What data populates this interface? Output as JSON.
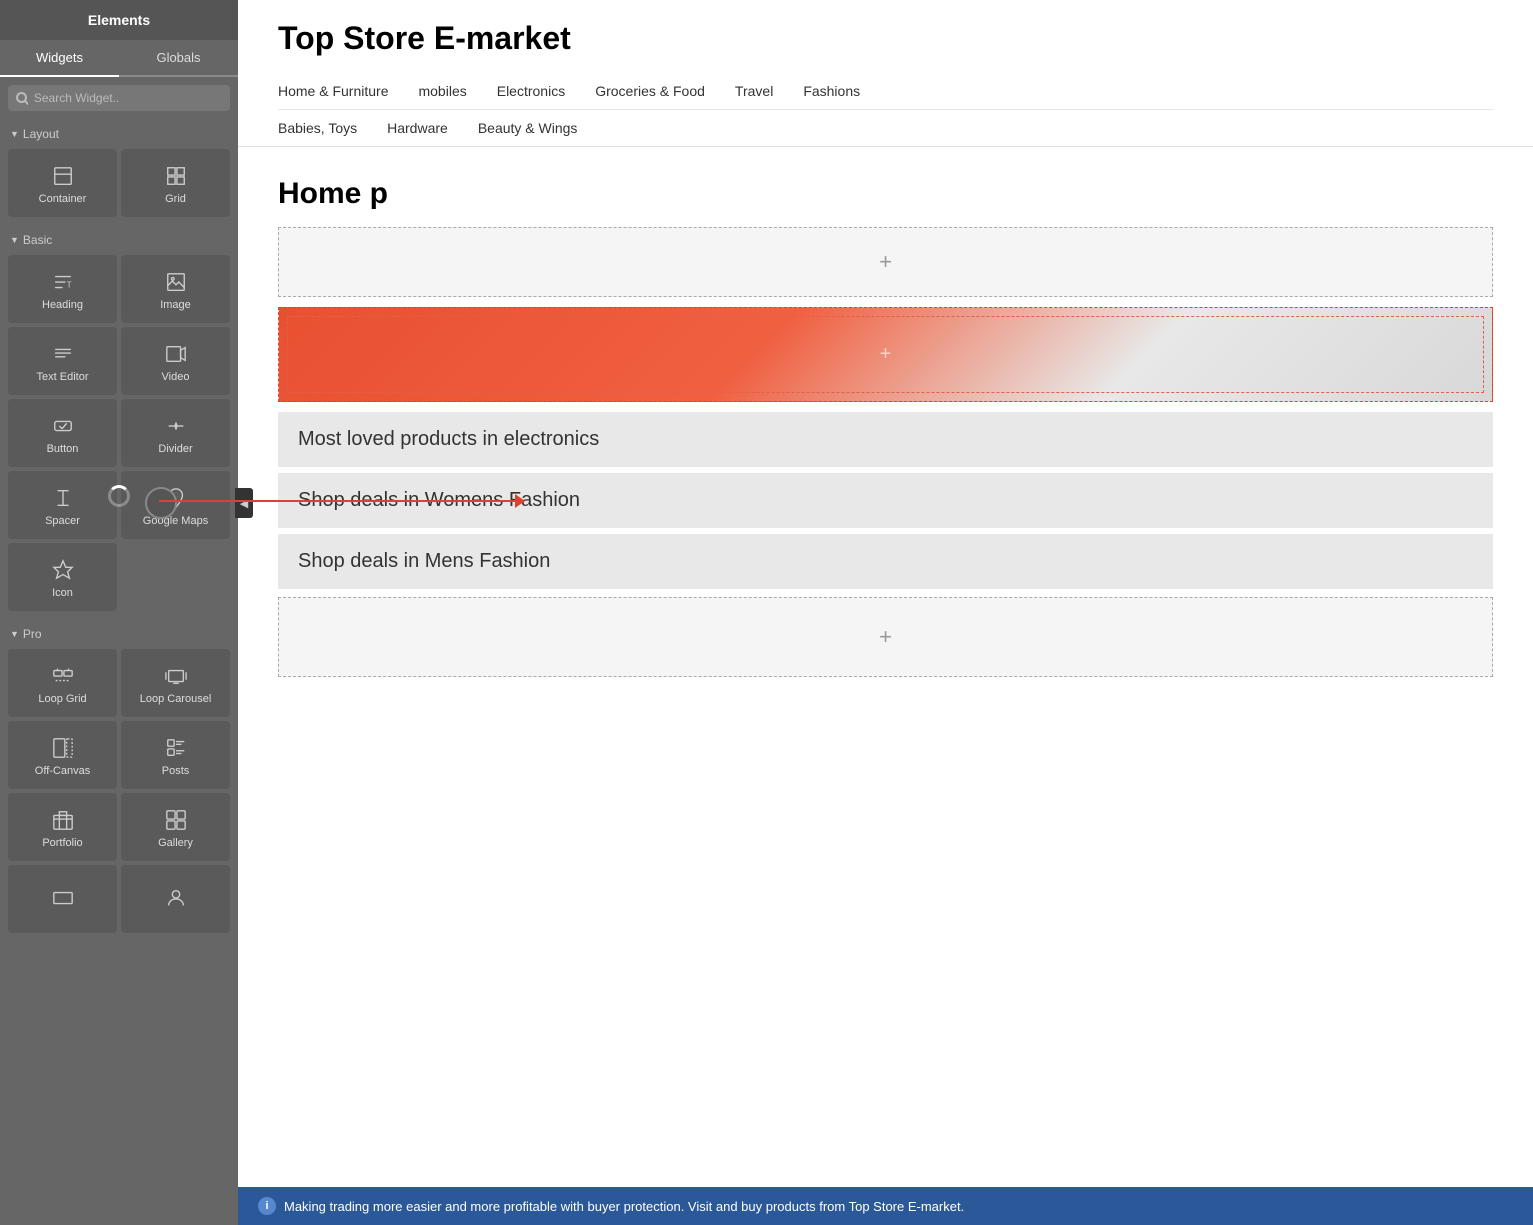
{
  "sidebar": {
    "title": "Elements",
    "tabs": [
      {
        "label": "Widgets",
        "active": true
      },
      {
        "label": "Globals",
        "active": false
      }
    ],
    "search": {
      "placeholder": "Search Widget.."
    },
    "sections": {
      "layout": {
        "label": "Layout",
        "widgets": [
          {
            "name": "container",
            "label": "Container"
          },
          {
            "name": "grid",
            "label": "Grid"
          }
        ]
      },
      "basic": {
        "label": "Basic",
        "widgets": [
          {
            "name": "heading",
            "label": "Heading"
          },
          {
            "name": "image",
            "label": "Image"
          },
          {
            "name": "text-editor",
            "label": "Text Editor"
          },
          {
            "name": "video",
            "label": "Video"
          },
          {
            "name": "button",
            "label": "Button"
          },
          {
            "name": "divider",
            "label": "Divider"
          },
          {
            "name": "spacer",
            "label": "Spacer"
          },
          {
            "name": "google-maps",
            "label": "Google Maps"
          },
          {
            "name": "icon",
            "label": "Icon"
          }
        ]
      },
      "pro": {
        "label": "Pro",
        "widgets": [
          {
            "name": "loop-grid",
            "label": "Loop Grid"
          },
          {
            "name": "loop-carousel",
            "label": "Loop Carousel"
          },
          {
            "name": "off-canvas",
            "label": "Off-Canvas"
          },
          {
            "name": "posts",
            "label": "Posts"
          },
          {
            "name": "portfolio",
            "label": "Portfolio"
          },
          {
            "name": "gallery",
            "label": "Gallery"
          },
          {
            "name": "widget7",
            "label": ""
          },
          {
            "name": "widget8",
            "label": ""
          }
        ]
      }
    }
  },
  "store": {
    "title": "Top Store E-market",
    "nav_row1": [
      "Home & Furniture",
      "mobiles",
      "Electronics",
      "Groceries & Food",
      "Travel",
      "Fashions"
    ],
    "nav_row2": [
      "Babies, Toys",
      "Hardware",
      "Beauty & Wings"
    ],
    "page_title": "Home p",
    "sections": [
      {
        "type": "drop-empty"
      },
      {
        "type": "red-section"
      },
      {
        "type": "text-block",
        "text": "Most loved products in electronics"
      },
      {
        "type": "text-block",
        "text": "Shop deals in Womens Fashion"
      },
      {
        "type": "text-block",
        "text": "Shop deals in Mens Fashion"
      },
      {
        "type": "drop-empty"
      }
    ]
  },
  "bottom_bar": {
    "text": "Making trading more easier and more profitable with buyer protection. Visit and buy products from Top Store E-market."
  }
}
